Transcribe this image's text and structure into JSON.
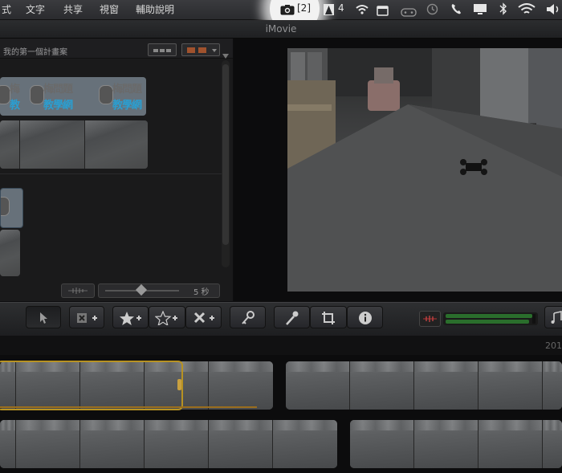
{
  "menubar": {
    "items": [
      "式",
      "文字",
      "共享",
      "視窗",
      "輔助說明"
    ],
    "screenshot_status": "[2]",
    "adobe_count": "4"
  },
  "window": {
    "title": "iMovie"
  },
  "browser": {
    "project_title": "我的第一個計畫案",
    "duration_label": "5 秒"
  },
  "timeline": {
    "right_label": "201"
  }
}
